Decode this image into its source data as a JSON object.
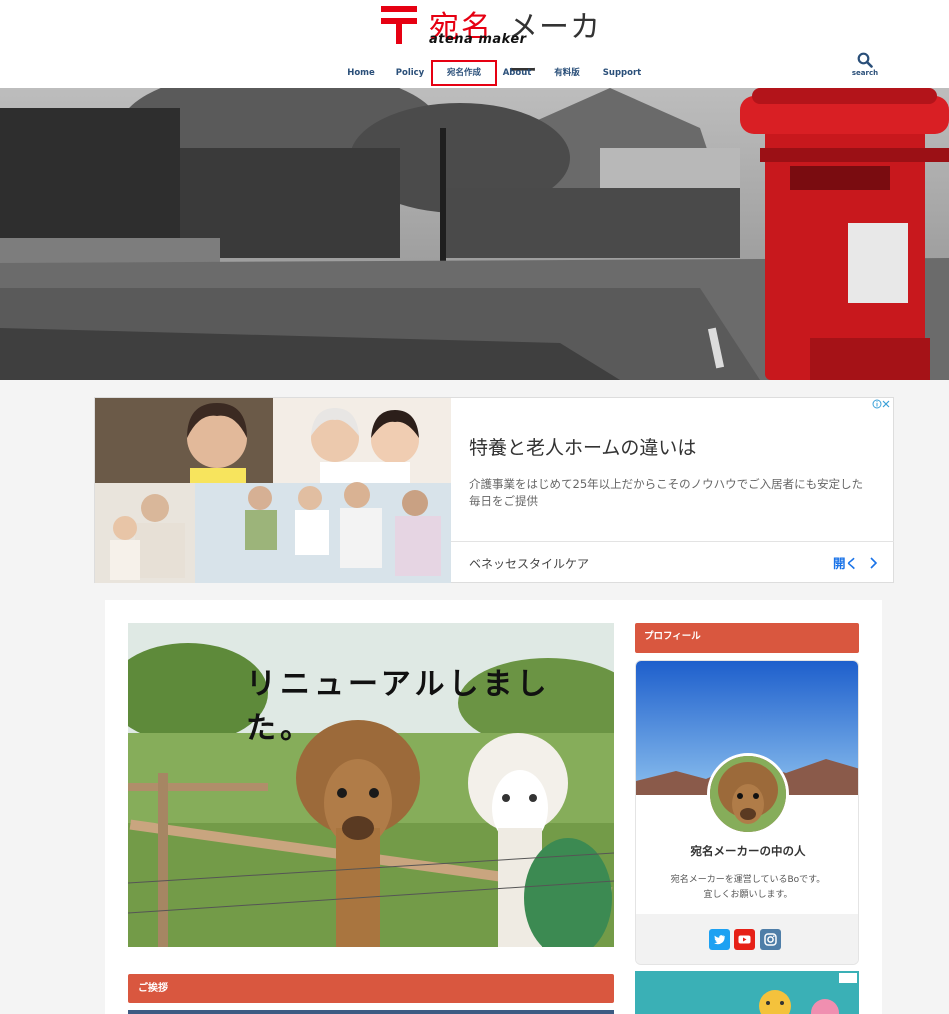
{
  "header": {
    "logo_jp_red": "宛名",
    "logo_jp_dark": "メーカー",
    "logo_en": "atena maker",
    "search_label": "search"
  },
  "nav": {
    "items": [
      {
        "label": "Home"
      },
      {
        "label": "Policy"
      },
      {
        "label": "宛名作成"
      },
      {
        "label": "About"
      },
      {
        "label": "有料版"
      },
      {
        "label": "Support"
      }
    ]
  },
  "ad": {
    "title": "特養と老人ホームの違いは",
    "description": "介護事業をはじめて25年以上だからこそのノウハウでご入居者にも安定した毎日をご提供",
    "advertiser": "ベネッセスタイルケア",
    "open_label": "開く"
  },
  "article": {
    "image_caption": "リニューアルしました。",
    "section_title": "ご挨拶"
  },
  "sidebar": {
    "profile_heading": "プロフィール",
    "profile_name": "宛名メーカーの中の人",
    "profile_desc_line1": "宛名メーカーを運営しているBoです。",
    "profile_desc_line2": "宜しくお願いします。"
  },
  "colors": {
    "accent_red": "#e60012",
    "nav_blue": "#2a4f79",
    "section_orange": "#d9573f",
    "twitter": "#1da1f2",
    "youtube": "#e62117",
    "instagram": "#4f7ea8"
  }
}
